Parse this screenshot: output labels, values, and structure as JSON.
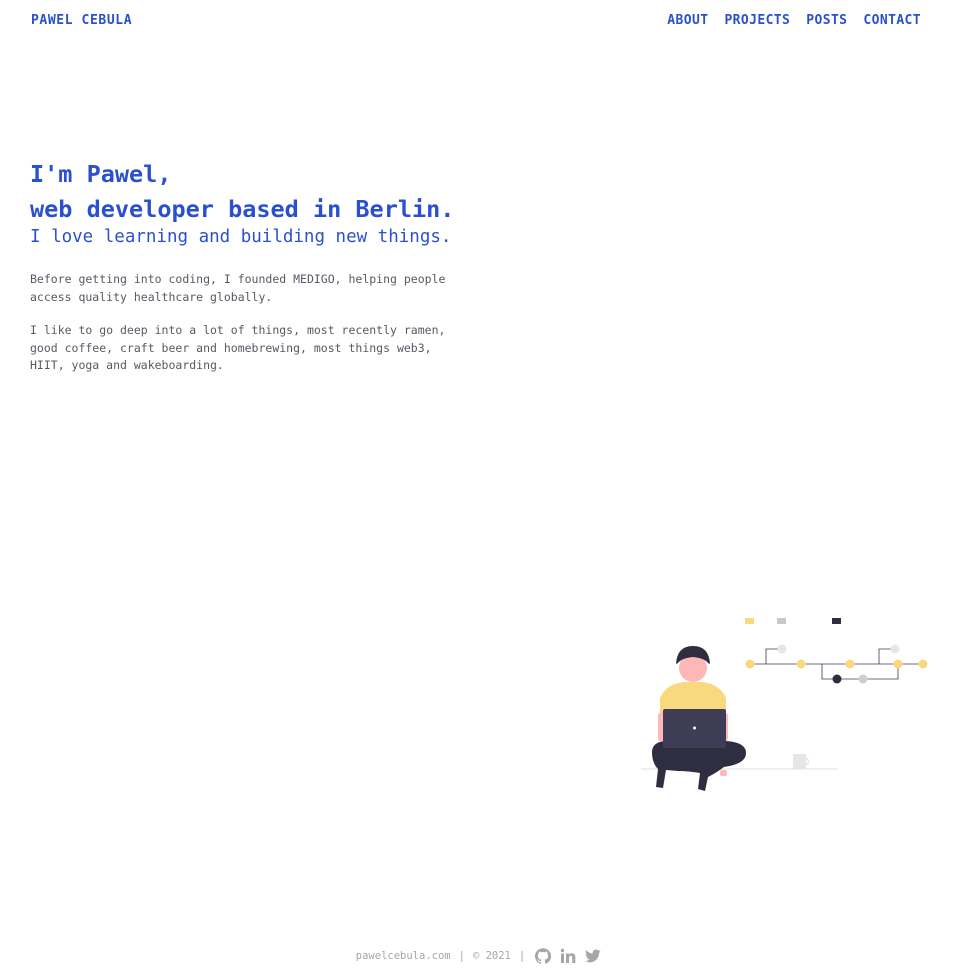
{
  "header": {
    "brand": "PAWEL CEBULA",
    "nav": [
      "ABOUT",
      "PROJECTS",
      "POSTS",
      "CONTACT"
    ]
  },
  "hero": {
    "line1": "I'm Pawel,",
    "line2": "web developer based in Berlin.",
    "tagline": "I love learning and building new things.",
    "paragraphs": [
      "Before getting into coding, I founded MEDIGO, helping people access quality healthcare globally.",
      "I like to go deep into a lot of things, most recently ramen, good coffee, craft beer and homebrewing, most things web3, HIIT, yoga and wakeboarding."
    ]
  },
  "footer": {
    "site": "pawelcebula.com",
    "copyright": "© 2021",
    "separator": "|",
    "icons": [
      "github-icon",
      "linkedin-icon",
      "twitter-icon"
    ]
  },
  "colors": {
    "accent": "#2b50cf",
    "text": "#555a63",
    "muted": "#a6a6a6",
    "illustration_yellow": "#f9d97e",
    "illustration_dark": "#2f2e41"
  }
}
